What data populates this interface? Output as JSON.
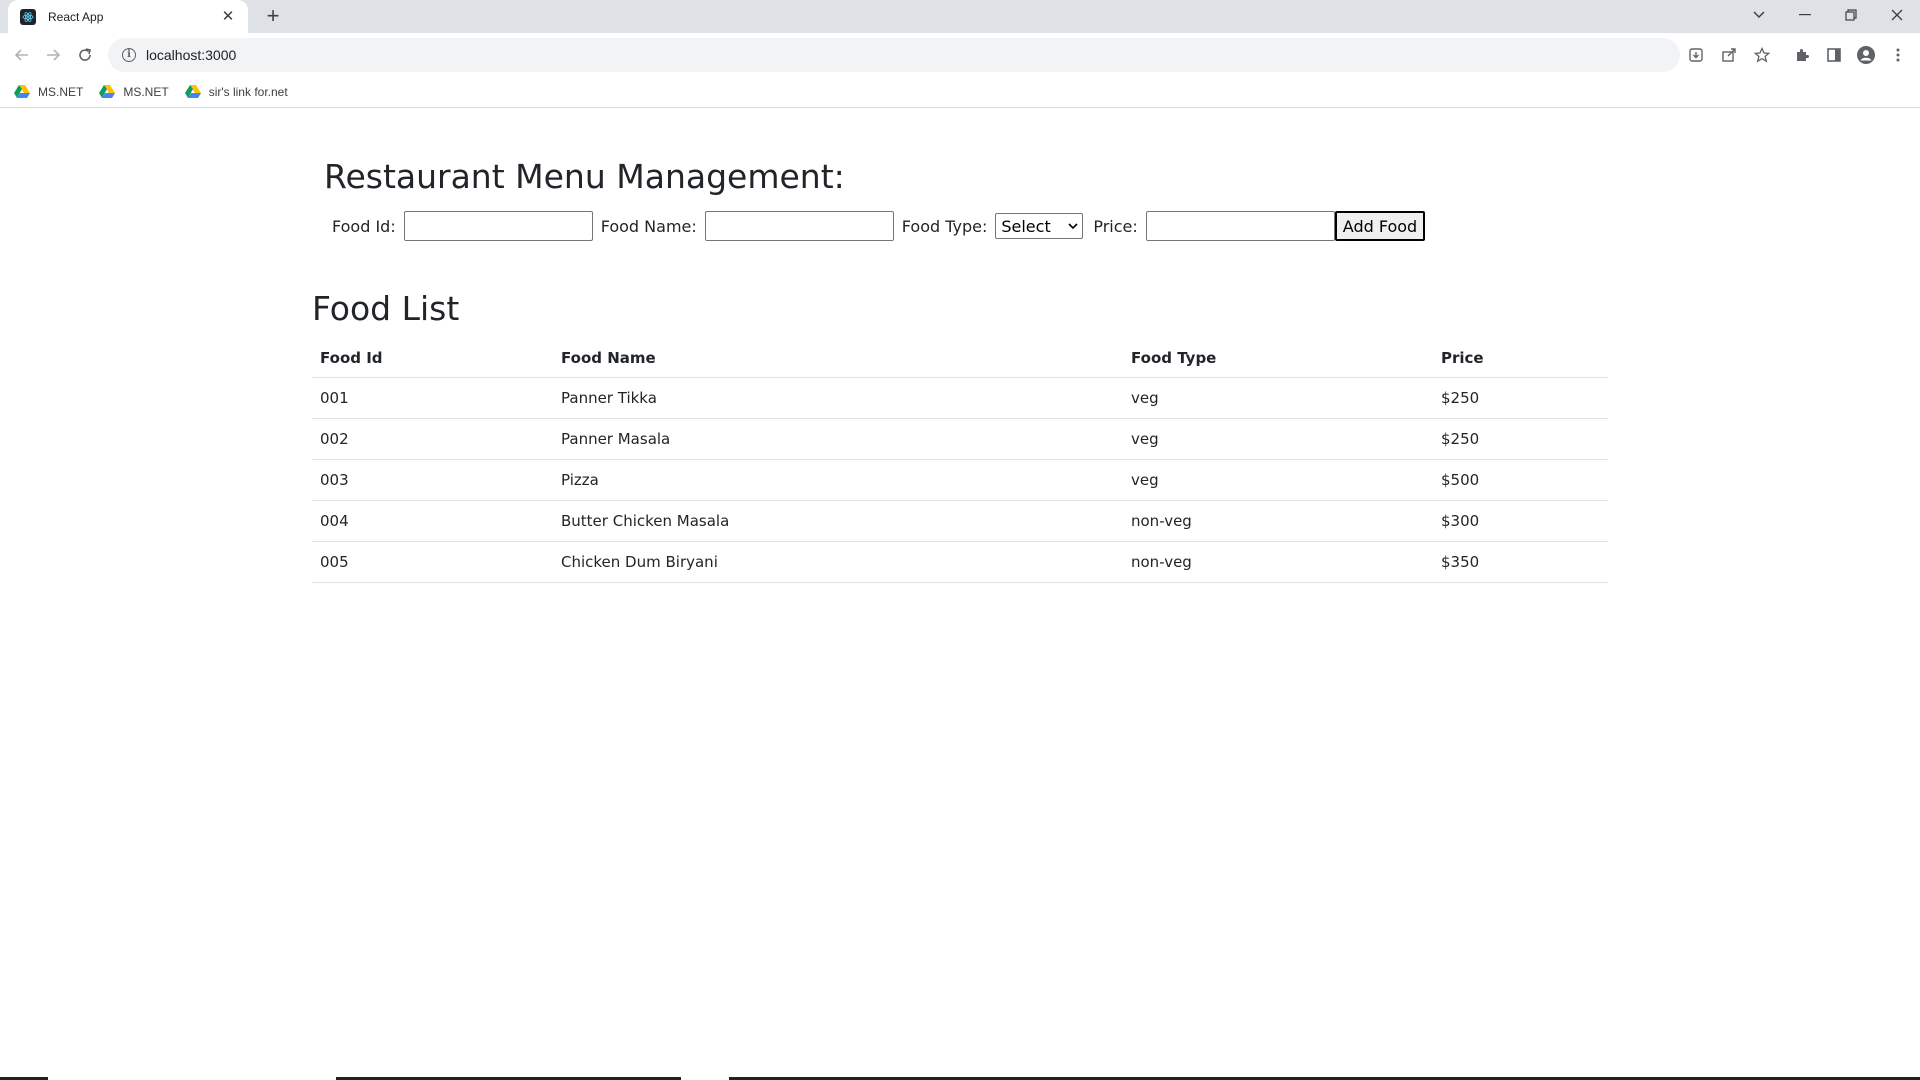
{
  "browser": {
    "tab_title": "React App",
    "tab_close": "✕",
    "new_tab": "+",
    "url": "localhost:3000",
    "bookmarks": [
      {
        "label": "MS.NET"
      },
      {
        "label": "MS.NET"
      },
      {
        "label": "sir's link for.net"
      }
    ]
  },
  "page": {
    "title": "Restaurant Menu Management:",
    "form": {
      "food_id_label": "Food Id:",
      "food_id_value": "",
      "food_name_label": "Food Name:",
      "food_name_value": "",
      "food_type_label": "Food Type:",
      "food_type_selected": "Select",
      "price_label": "Price:",
      "price_value": "",
      "add_button": "Add Food"
    },
    "list_title": "Food List",
    "table": {
      "headers": [
        "Food Id",
        "Food Name",
        "Food Type",
        "Price"
      ],
      "rows": [
        [
          "001",
          "Panner Tikka",
          "veg",
          "$250"
        ],
        [
          "002",
          "Panner Masala",
          "veg",
          "$250"
        ],
        [
          "003",
          "Pizza",
          "veg",
          "$500"
        ],
        [
          "004",
          "Butter Chicken Masala",
          "non-veg",
          "$300"
        ],
        [
          "005",
          "Chicken Dum Biryani",
          "non-veg",
          "$350"
        ]
      ]
    }
  },
  "colors": {
    "tabstrip": "#dee1e6",
    "omnibox": "#f1f3f4",
    "table_border": "#dee2e6",
    "text": "#212529"
  }
}
